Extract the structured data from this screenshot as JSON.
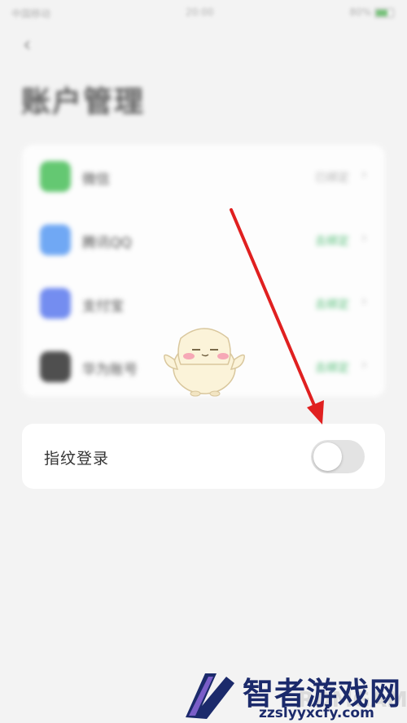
{
  "status_bar": {
    "carrier": "中国移动",
    "time": "20:00",
    "battery": "80%"
  },
  "header": {
    "back_icon": "back-arrow-icon",
    "title": "账户管理"
  },
  "accounts": [
    {
      "icon": "wechat-icon",
      "color": "#4cc15c",
      "label": "微信",
      "value": "已绑定",
      "value_color": "#aaaaaa"
    },
    {
      "icon": "tencent-icon",
      "color": "#5a9cf5",
      "label": "腾讯QQ",
      "value": "去绑定",
      "value_color": "#42b86a"
    },
    {
      "icon": "alipay-icon",
      "color": "#5e7cf0",
      "label": "支付宝",
      "value": "去绑定",
      "value_color": "#42b86a"
    },
    {
      "icon": "app-icon",
      "color": "#333333",
      "label": "华为账号",
      "value": "去绑定",
      "value_color": "#42b86a"
    }
  ],
  "fingerprint": {
    "label": "指纹登录",
    "enabled": false
  },
  "annotation": {
    "arrow_color": "#e02020"
  },
  "watermark": {
    "title": "智者游戏网",
    "url": "zzslyyxcfy.com",
    "overlay": "RDMGAME"
  }
}
